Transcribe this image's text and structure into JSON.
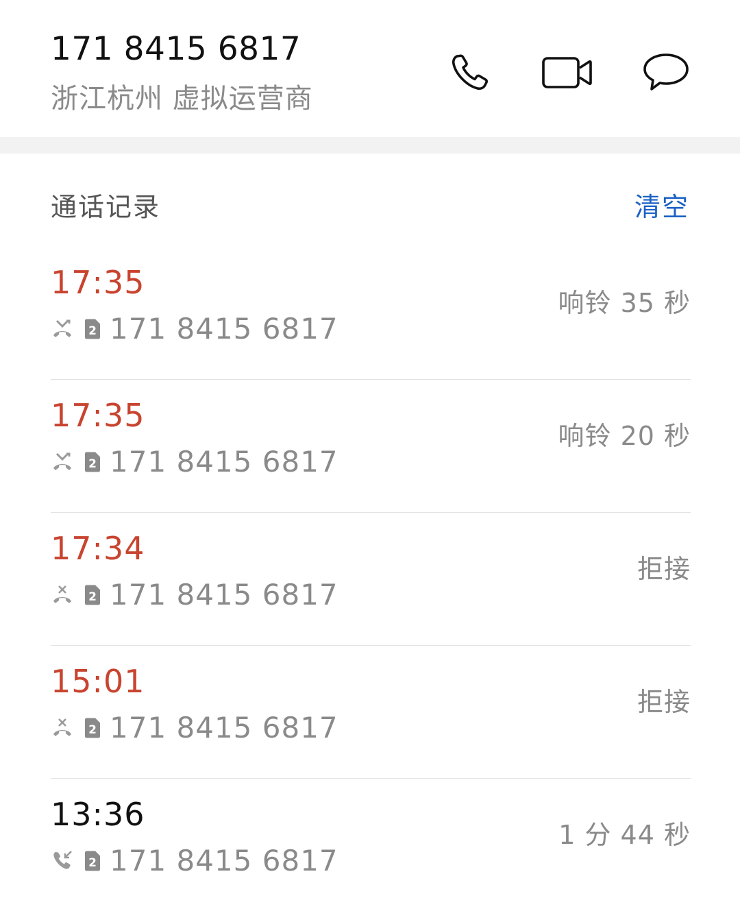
{
  "contact": {
    "number": "171 8415 6817",
    "location": "浙江杭州 虚拟运营商"
  },
  "actions": {
    "call_icon": "phone-icon",
    "video_icon": "video-camera-icon",
    "message_icon": "chat-bubble-icon"
  },
  "call_log": {
    "title": "通话记录",
    "clear_label": "清空",
    "records": [
      {
        "time": "17:35",
        "type": "missed",
        "sim": "2",
        "number": "171 8415 6817",
        "status": "响铃 35 秒"
      },
      {
        "time": "17:35",
        "type": "missed",
        "sim": "2",
        "number": "171 8415 6817",
        "status": "响铃 20 秒"
      },
      {
        "time": "17:34",
        "type": "rejected",
        "sim": "2",
        "number": "171 8415 6817",
        "status": "拒接"
      },
      {
        "time": "15:01",
        "type": "rejected",
        "sim": "2",
        "number": "171 8415 6817",
        "status": "拒接"
      },
      {
        "time": "13:36",
        "type": "incoming",
        "sim": "2",
        "number": "171 8415 6817",
        "status": "1 分 44 秒"
      }
    ]
  },
  "colors": {
    "missed": "#c8442f",
    "accent": "#1b62c4",
    "secondary_text": "#8a8a8a"
  }
}
